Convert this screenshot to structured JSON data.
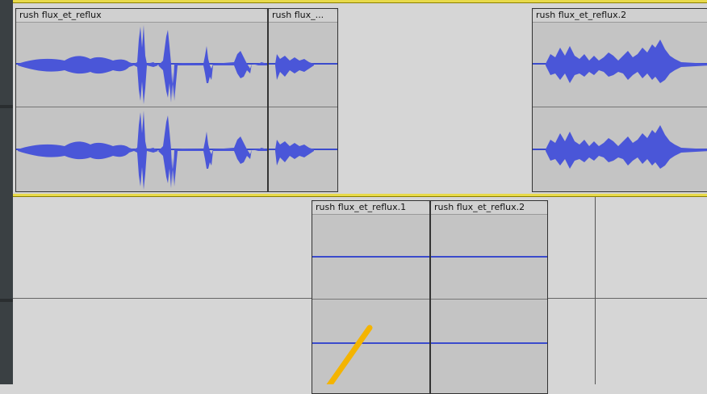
{
  "top_track": {
    "clips": [
      {
        "label": "rush flux_et_reflux"
      },
      {
        "label": "rush flux_..."
      },
      {
        "label": "rush flux_et_reflux.2"
      }
    ]
  },
  "bottom_track": {
    "clips": [
      {
        "label": "rush flux_et_reflux.1"
      },
      {
        "label": "rush flux_et_reflux.2"
      }
    ]
  },
  "colors": {
    "waveform": "#4a56d8",
    "track_highlight": "#e8da4a",
    "pointer": "#f4b400"
  }
}
